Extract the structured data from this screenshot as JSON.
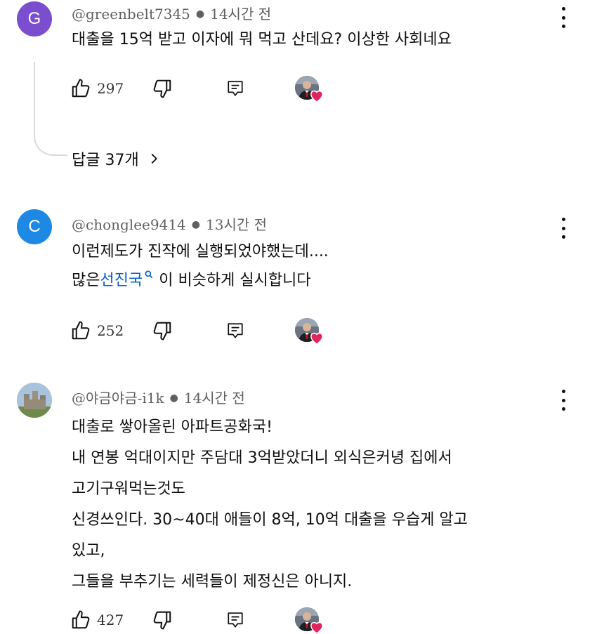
{
  "comments": [
    {
      "avatar_letter": "G",
      "avatar_color": "#7b4ecf",
      "handle": "@greenbelt7345",
      "time": "14시간 전",
      "lines": [
        "대출을 15억 받고 이자에 뭐 먹고 산데요? 이상한 사회네요"
      ],
      "likes": "297",
      "replies_label": "답글 37개"
    },
    {
      "avatar_letter": "C",
      "avatar_color": "#1e88e5",
      "handle": "@chonglee9414",
      "time": "13시간 전",
      "line1": "이런제도가 진작에 실행되었야했는데....",
      "line2_prefix": "많은",
      "line2_link": "선진국",
      "line2_suffix": " 이 비슷하게 실시합니다",
      "likes": "252"
    },
    {
      "avatar_letter": "",
      "handle": "@야금야금-i1k",
      "time": "14시간 전",
      "lines": [
        "대출로 쌓아올린 아파트공화국!",
        "내 연봉 억대이지만 주담대 3억받았더니 외식은커녕 집에서",
        "고기구워먹는것도",
        "신경쓰인다. 30~40대 애들이 8억, 10억 대출을 우습게 알고",
        "있고,",
        "그들을 부추기는 세력들이 제정신은 아니지."
      ],
      "likes": "427"
    }
  ],
  "icons": {
    "like": "thumbs-up-icon",
    "dislike": "thumbs-down-icon",
    "reply": "reply-icon",
    "more": "more-vert-icon",
    "heart": "creator-heart-icon",
    "search": "search-icon",
    "chevron": "chevron-right-icon"
  },
  "colors": {
    "link": "#065fd4",
    "heart": "#e0245e",
    "meta": "#606060"
  }
}
